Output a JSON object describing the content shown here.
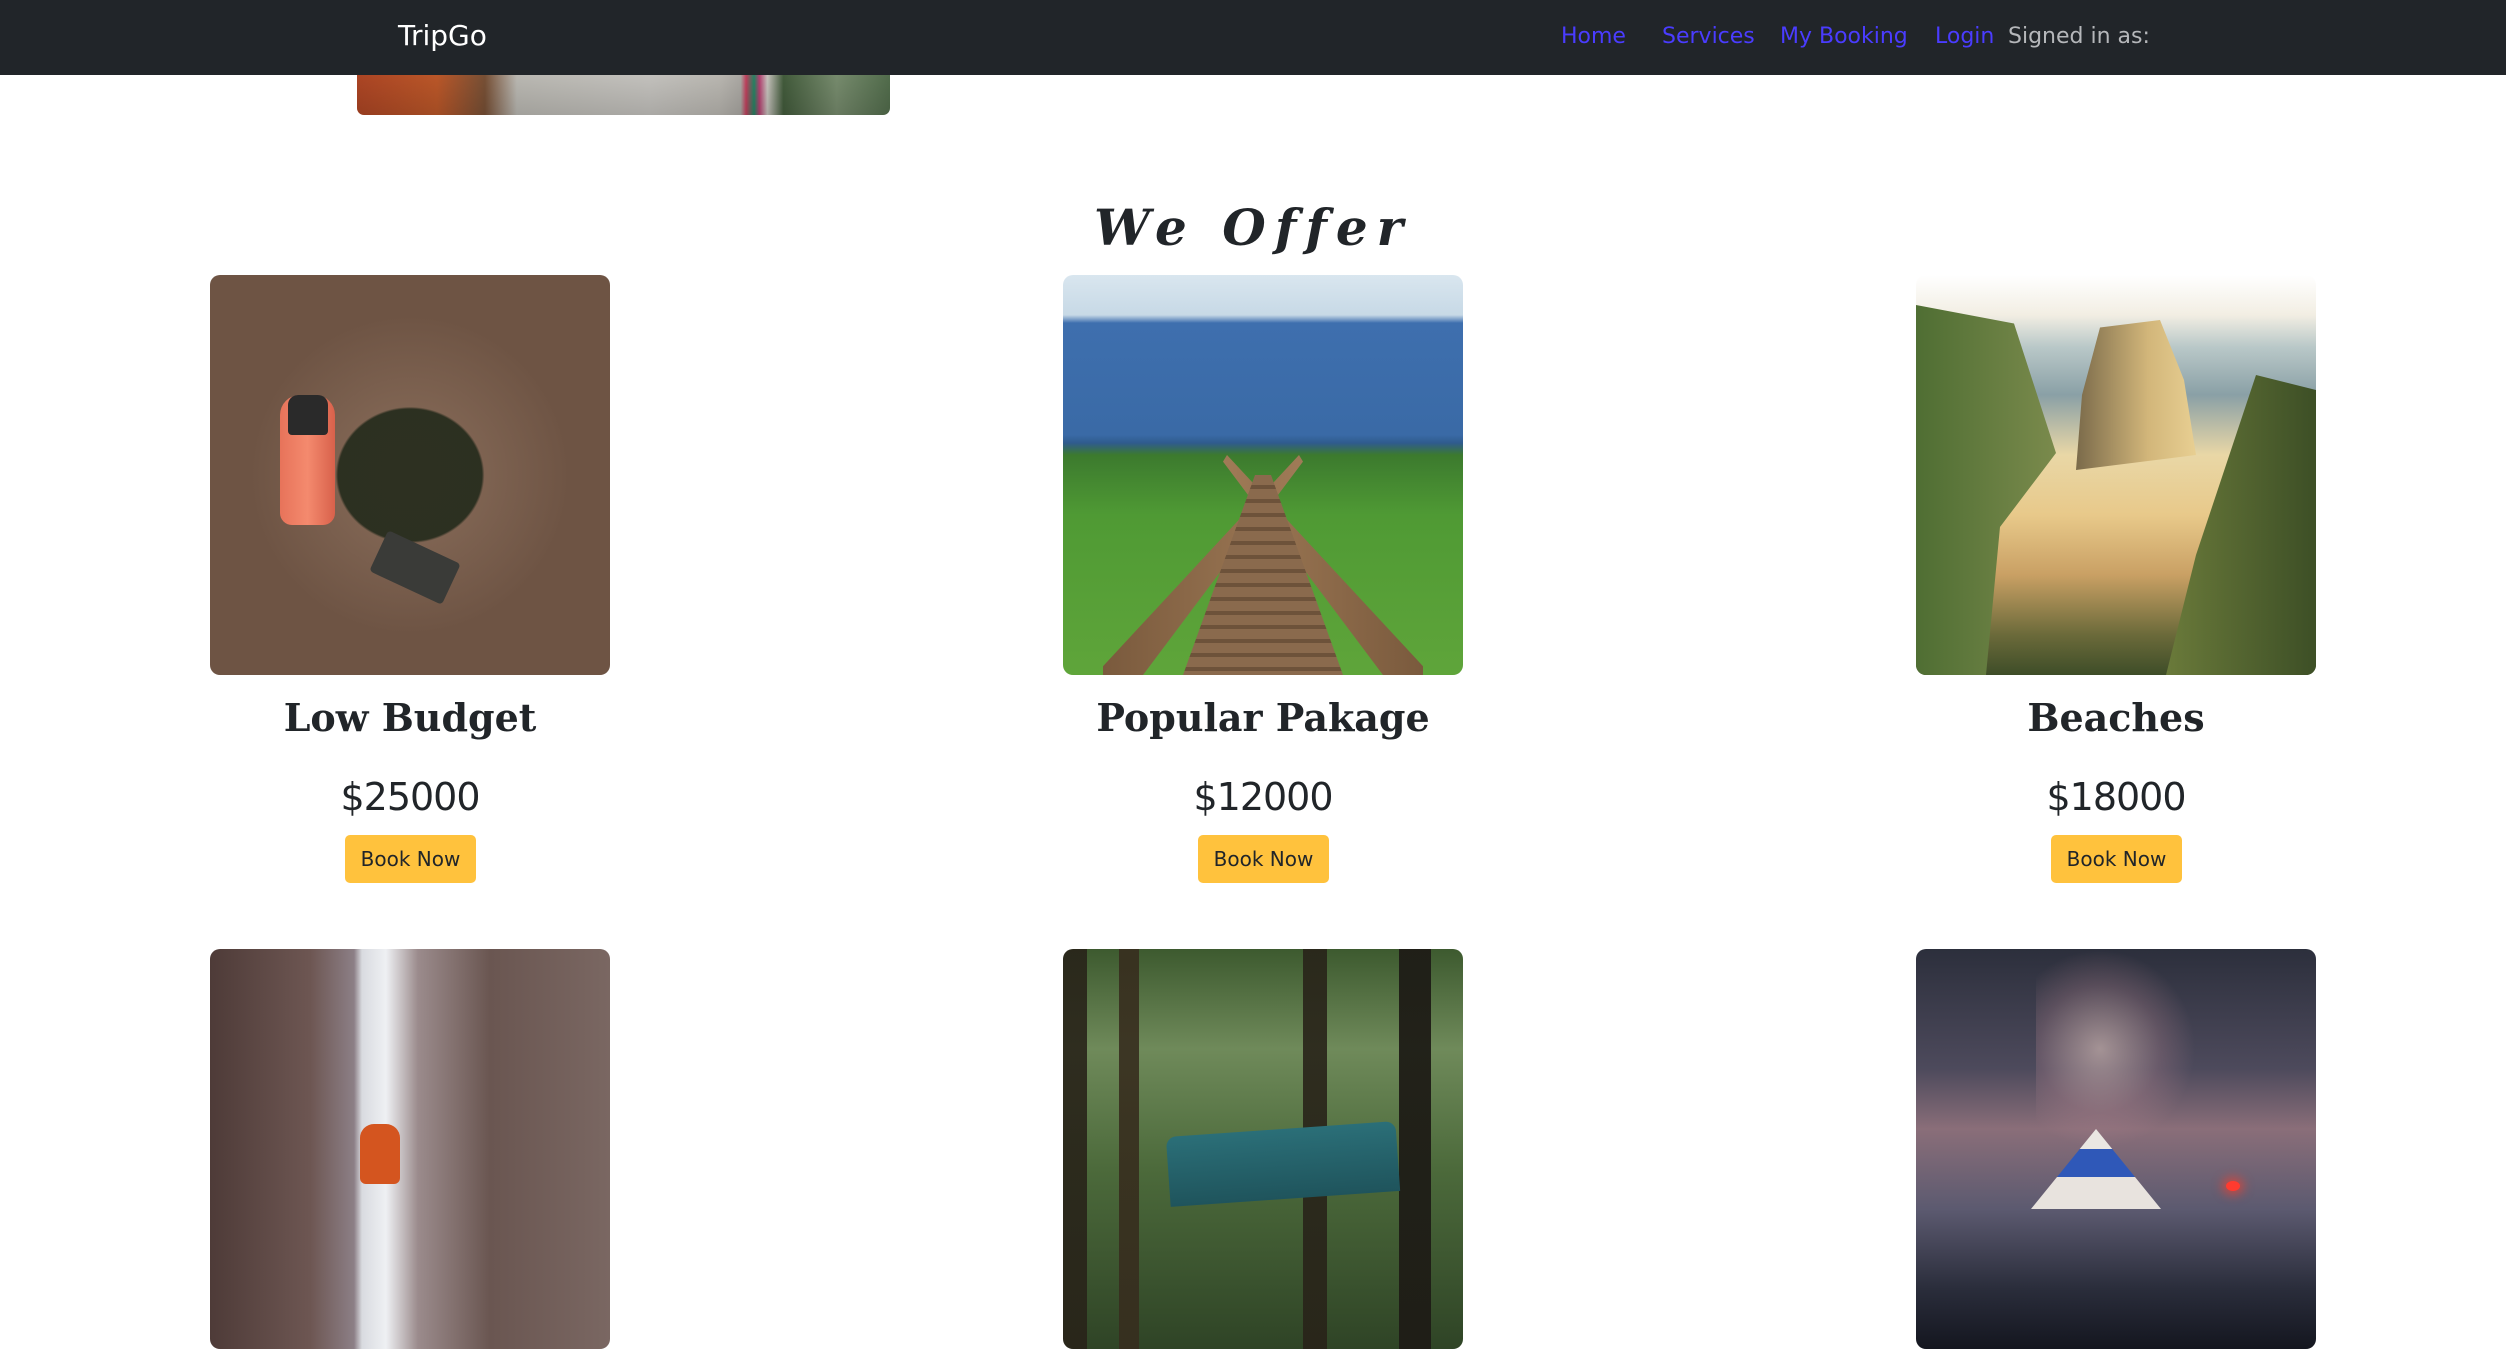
{
  "navbar": {
    "brand": "TripGo",
    "links": [
      {
        "label": "Home"
      },
      {
        "label": "Services"
      },
      {
        "label": "My Booking"
      },
      {
        "label": "Login"
      }
    ],
    "signed_in_label": "Signed in as:",
    "link_color": "#4a3cff",
    "background": "#212529"
  },
  "offers": {
    "title": "We Offer",
    "cards": [
      {
        "title": "Low Budget",
        "price": "$25000",
        "button": "Book Now"
      },
      {
        "title": "Popular Pakage",
        "price": "$12000",
        "button": "Book Now"
      },
      {
        "title": "Beaches",
        "price": "$18000",
        "button": "Book Now"
      },
      {
        "title": "",
        "price": "",
        "button": ""
      },
      {
        "title": "",
        "price": "",
        "button": ""
      },
      {
        "title": "",
        "price": "",
        "button": ""
      }
    ],
    "button_color": "#ffc23d"
  }
}
